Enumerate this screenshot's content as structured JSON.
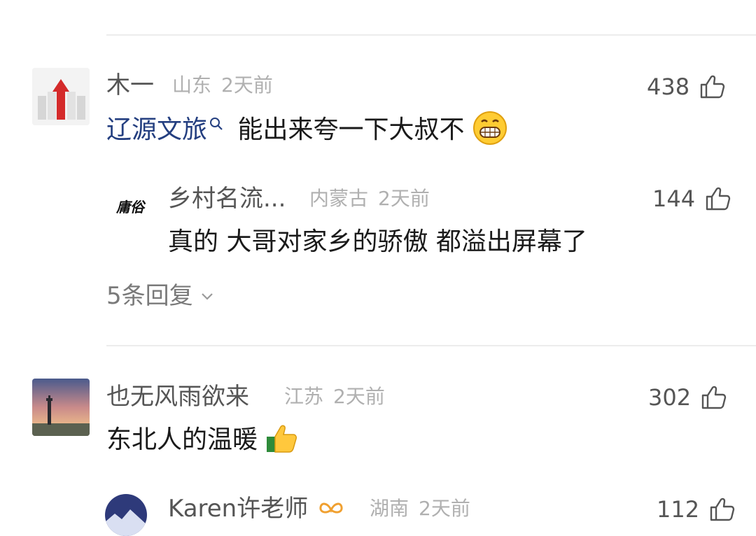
{
  "comments": [
    {
      "username": "木一",
      "location": "山东",
      "time": "2天前",
      "likes": "438",
      "mention": "辽源文旅",
      "text": "能出来夸一下大叔不",
      "emoji": "grinning-face-emoji",
      "reply": {
        "avatar_text": "庸俗",
        "username": "乡村名流...",
        "location": "内蒙古",
        "time": "2天前",
        "likes": "144",
        "text": "真的 大哥对家乡的骄傲 都溢出屏幕了"
      },
      "more_replies": "5条回复"
    },
    {
      "username": "也无风雨欲来",
      "location": "江苏",
      "time": "2天前",
      "likes": "302",
      "text": "东北人的温暖",
      "emoji": "thumbs-up-emoji",
      "reply": {
        "username": "Karen许老师",
        "location": "湖南",
        "time": "2天前",
        "likes": "112"
      }
    }
  ],
  "colors": {
    "mention": "#243f80",
    "meta": "#b0b0b0",
    "name": "#555555"
  }
}
